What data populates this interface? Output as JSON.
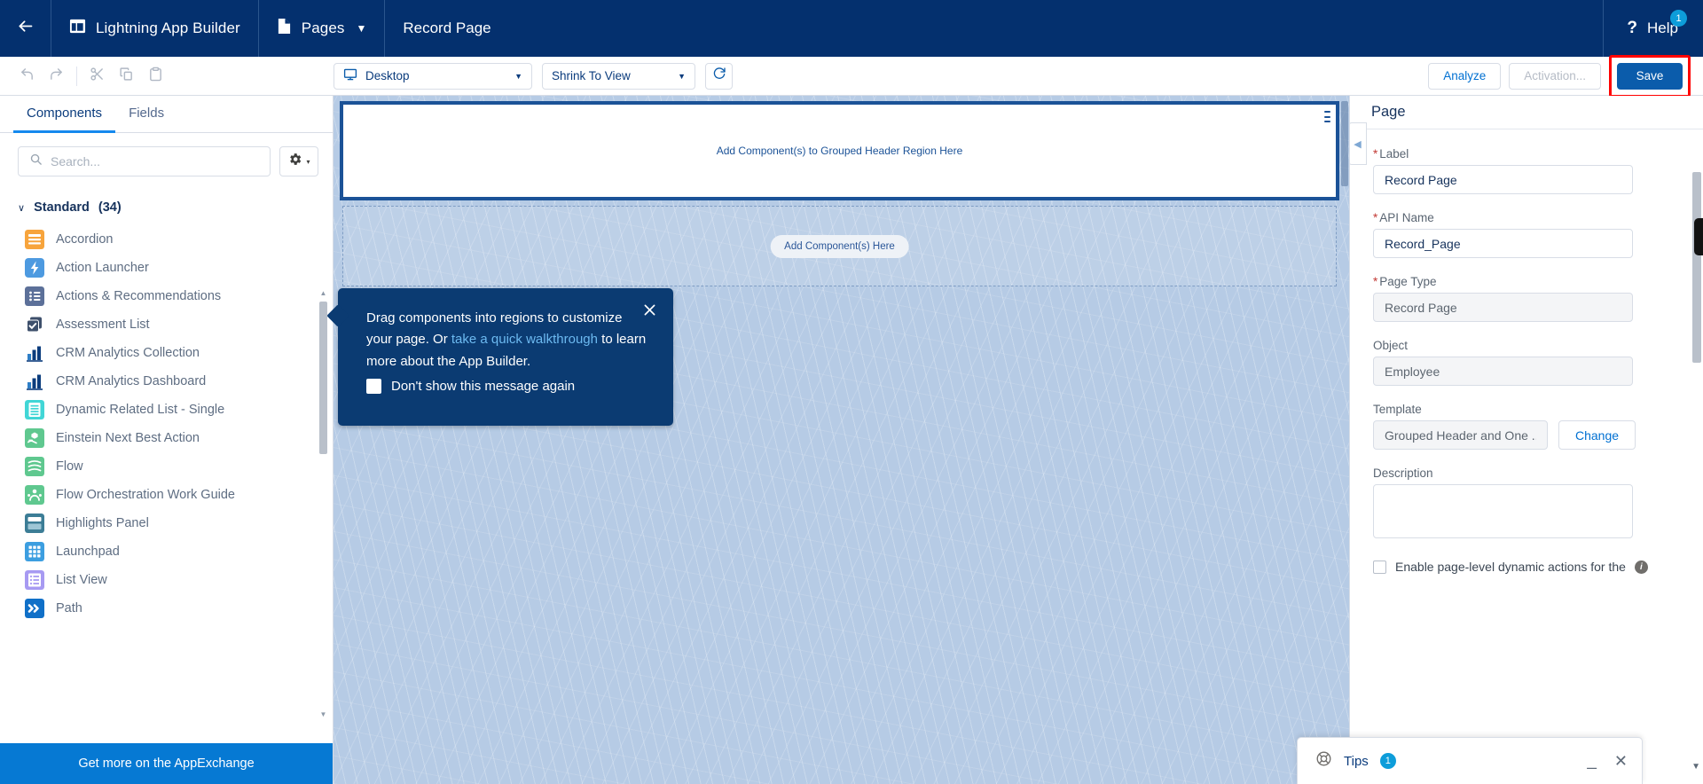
{
  "header": {
    "back_icon": "arrow-left-icon",
    "app_icon": "app-builder-icon",
    "app_title": "Lightning App Builder",
    "pages_icon": "document-icon",
    "pages_label": "Pages",
    "pages_caret": "▼",
    "page_name": "Record Page",
    "help_icon": "question-mark-icon",
    "help_label": "Help",
    "help_badge": "1"
  },
  "toolbar": {
    "undo_icon": "undo-icon",
    "redo_icon": "redo-icon",
    "cut_icon": "scissors-icon",
    "copy_icon": "copy-icon",
    "paste_icon": "clipboard-icon",
    "device_icon": "desktop-icon",
    "device_value": "Desktop",
    "zoom_value": "Shrink To View",
    "caret": "▼",
    "refresh_icon": "refresh-icon",
    "analyze_label": "Analyze",
    "activation_label": "Activation...",
    "save_label": "Save",
    "save_highlight_color": "#ff0000"
  },
  "left_panel": {
    "tabs": [
      {
        "label": "Components",
        "active": true
      },
      {
        "label": "Fields",
        "active": false
      }
    ],
    "search": {
      "icon": "search-icon",
      "value": "",
      "placeholder": "Search..."
    },
    "settings_icon": "gear-icon",
    "settings_caret": "▾",
    "section": {
      "caret": "∨",
      "label": "Standard",
      "count": "(34)"
    },
    "components": [
      {
        "label": "Accordion",
        "icon": "accordion-icon",
        "color": "#f5a623"
      },
      {
        "label": "Action Launcher",
        "icon": "action-launcher-icon",
        "color": "#4a90d9"
      },
      {
        "label": "Actions & Recommendations",
        "icon": "actions-recommendations-icon",
        "color": "#5c7099"
      },
      {
        "label": "Assessment List",
        "icon": "assessment-list-icon",
        "color": "#3d4f6b"
      },
      {
        "label": "CRM Analytics Collection",
        "icon": "crm-analytics-collection-icon",
        "color": "#0b3c7d"
      },
      {
        "label": "CRM Analytics Dashboard",
        "icon": "crm-analytics-dashboard-icon",
        "color": "#0b3c7d"
      },
      {
        "label": "Dynamic Related List - Single",
        "icon": "dynamic-related-list-icon",
        "color": "#41d6d6"
      },
      {
        "label": "Einstein Next Best Action",
        "icon": "einstein-next-best-action-icon",
        "color": "#5fc88f"
      },
      {
        "label": "Flow",
        "icon": "flow-icon",
        "color": "#5fc88f"
      },
      {
        "label": "Flow Orchestration Work Guide",
        "icon": "flow-orchestration-icon",
        "color": "#5fc88f"
      },
      {
        "label": "Highlights Panel",
        "icon": "highlights-panel-icon",
        "color": "#3c7d96"
      },
      {
        "label": "Launchpad",
        "icon": "launchpad-icon",
        "color": "#3c9ee0"
      },
      {
        "label": "List View",
        "icon": "list-view-icon",
        "color": "#9a8ff0"
      },
      {
        "label": "Path",
        "icon": "path-icon",
        "color": "#1070c8"
      }
    ],
    "appexchange_label": "Get more on the AppExchange"
  },
  "canvas": {
    "header_region_label": "Add Component(s) to Grouped Header Region Here",
    "body_region_label": "Add Component(s) Here",
    "grip_icon": "drag-grip-icon"
  },
  "popover": {
    "close_icon": "close-icon",
    "text_before": "Drag components into regions to customize your page. Or ",
    "link_text": "take a quick walkthrough",
    "text_after": " to learn more about the App Builder.",
    "checkbox_label": "Don't show this message again",
    "checkbox_checked": false
  },
  "right_panel": {
    "title": "Page",
    "collapse_icon": "chevron-left-icon",
    "fields": {
      "label_title": "Label",
      "label_value": "Record Page",
      "api_title": "API Name",
      "api_value": "Record_Page",
      "page_type_title": "Page Type",
      "page_type_value": "Record Page",
      "object_title": "Object",
      "object_value": "Employee",
      "template_title": "Template",
      "template_value": "Grouped Header and One ...",
      "change_label": "Change",
      "description_title": "Description",
      "description_value": ""
    },
    "dynamic_actions_label": "Enable page-level dynamic actions for the",
    "info_icon": "info-icon",
    "required_marker": "*"
  },
  "tips": {
    "icon": "lifebuoy-icon",
    "label": "Tips",
    "badge": "1",
    "minimize_icon": "minimize-icon",
    "close_icon": "close-icon"
  }
}
